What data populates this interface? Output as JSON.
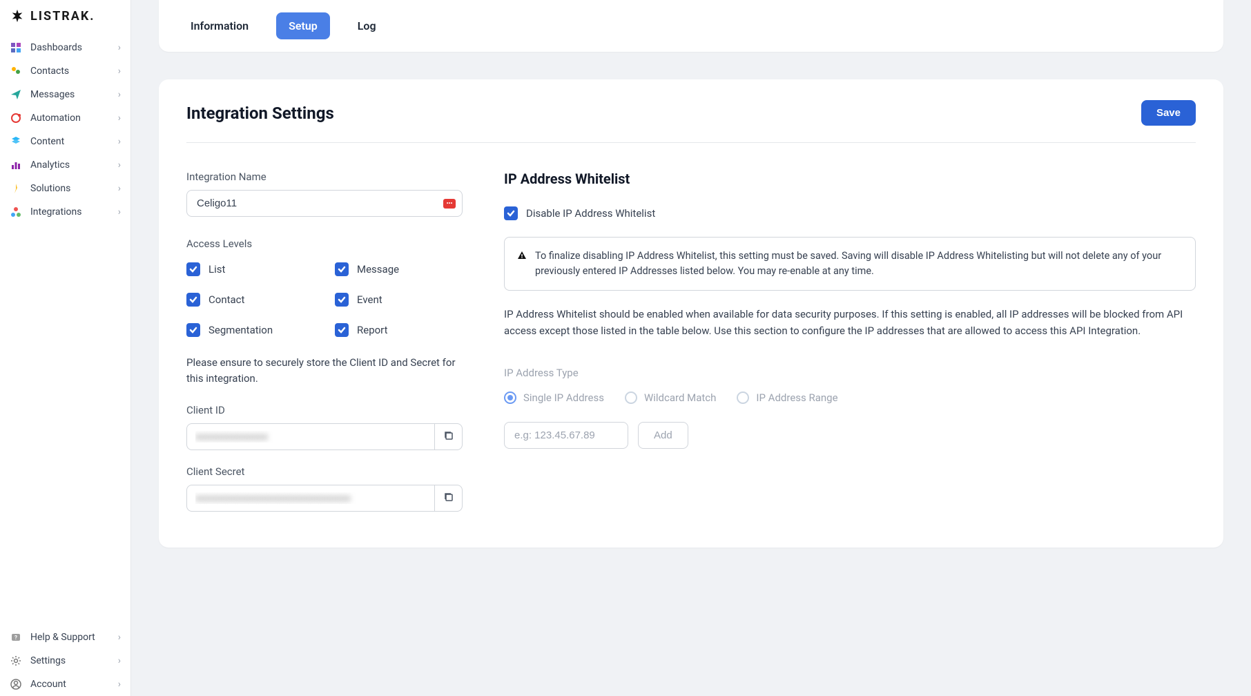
{
  "brand": "LISTRAK.",
  "sidebar": {
    "main": [
      {
        "label": "Dashboards"
      },
      {
        "label": "Contacts"
      },
      {
        "label": "Messages"
      },
      {
        "label": "Automation"
      },
      {
        "label": "Content"
      },
      {
        "label": "Analytics"
      },
      {
        "label": "Solutions"
      },
      {
        "label": "Integrations"
      }
    ],
    "footer": [
      {
        "label": "Help & Support"
      },
      {
        "label": "Settings"
      },
      {
        "label": "Account"
      }
    ]
  },
  "tabs": {
    "information": "Information",
    "setup": "Setup",
    "log": "Log"
  },
  "settings": {
    "title": "Integration Settings",
    "save": "Save",
    "integration_name_label": "Integration Name",
    "integration_name_value": "Celigo11",
    "access_levels_label": "Access Levels",
    "access": {
      "list": "List",
      "message": "Message",
      "contact": "Contact",
      "event": "Event",
      "segmentation": "Segmentation",
      "report": "Report"
    },
    "store_note": "Please ensure to securely store the Client ID and Secret for this integration.",
    "client_id_label": "Client ID",
    "client_id_value": "xxxxxxxxxxxxxx",
    "client_secret_label": "Client Secret",
    "client_secret_value": "xxxxxxxxxxxxxxxxxxxxxxxxxxxxxx"
  },
  "whitelist": {
    "title": "IP Address Whitelist",
    "disable_label": "Disable IP Address Whitelist",
    "alert": "To finalize disabling IP Address Whitelist, this setting must be saved. Saving will disable IP Address Whitelisting but will not delete any of your previously entered IP Addresses listed below. You may re-enable at any time.",
    "description": "IP Address Whitelist should be enabled when available for data security purposes. If this setting is enabled, all IP addresses will be blocked from API access except those listed in the table below. Use this section to configure the IP addresses that are allowed to access this API Integration.",
    "type_label": "IP Address Type",
    "radios": {
      "single": "Single IP Address",
      "wildcard": "Wildcard Match",
      "range": "IP Address Range"
    },
    "ip_placeholder": "e.g: 123.45.67.89",
    "add": "Add"
  }
}
